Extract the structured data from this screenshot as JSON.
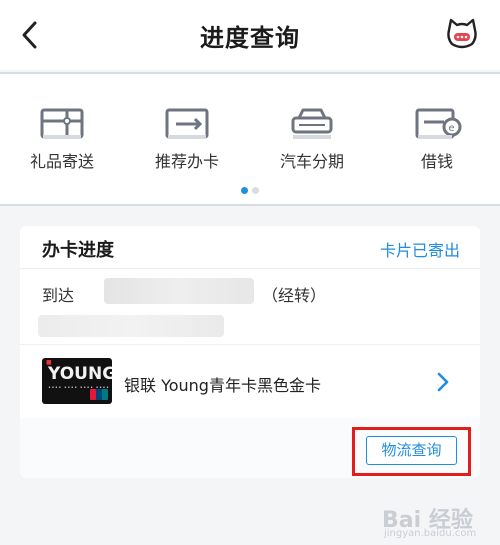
{
  "header": {
    "title": "进度查询",
    "back_icon": "chevron-left-icon",
    "assistant_icon": "cat-face-icon"
  },
  "services": {
    "items": [
      {
        "label": "礼品寄送",
        "icon": "gift-icon"
      },
      {
        "label": "推荐办卡",
        "icon": "card-recommend-icon"
      },
      {
        "label": "汽车分期",
        "icon": "car-icon"
      },
      {
        "label": "借钱",
        "icon": "loan-card-icon"
      }
    ],
    "pager": {
      "count": 2,
      "active": 1
    }
  },
  "progress_card": {
    "title": "办卡进度",
    "status": "卡片已寄出",
    "arrive_label": "到达",
    "transfer_note": "（经转）",
    "product": {
      "card_text": "YOUNG",
      "name": "银联 Young青年卡黑色金卡"
    },
    "track_button": "物流查询"
  },
  "watermark": {
    "text": "Bai 经验",
    "sub": "jingyan.baidu.com"
  },
  "colors": {
    "accent": "#1f8de0",
    "highlight": "#e31c1c",
    "background": "#f4f5f7"
  }
}
